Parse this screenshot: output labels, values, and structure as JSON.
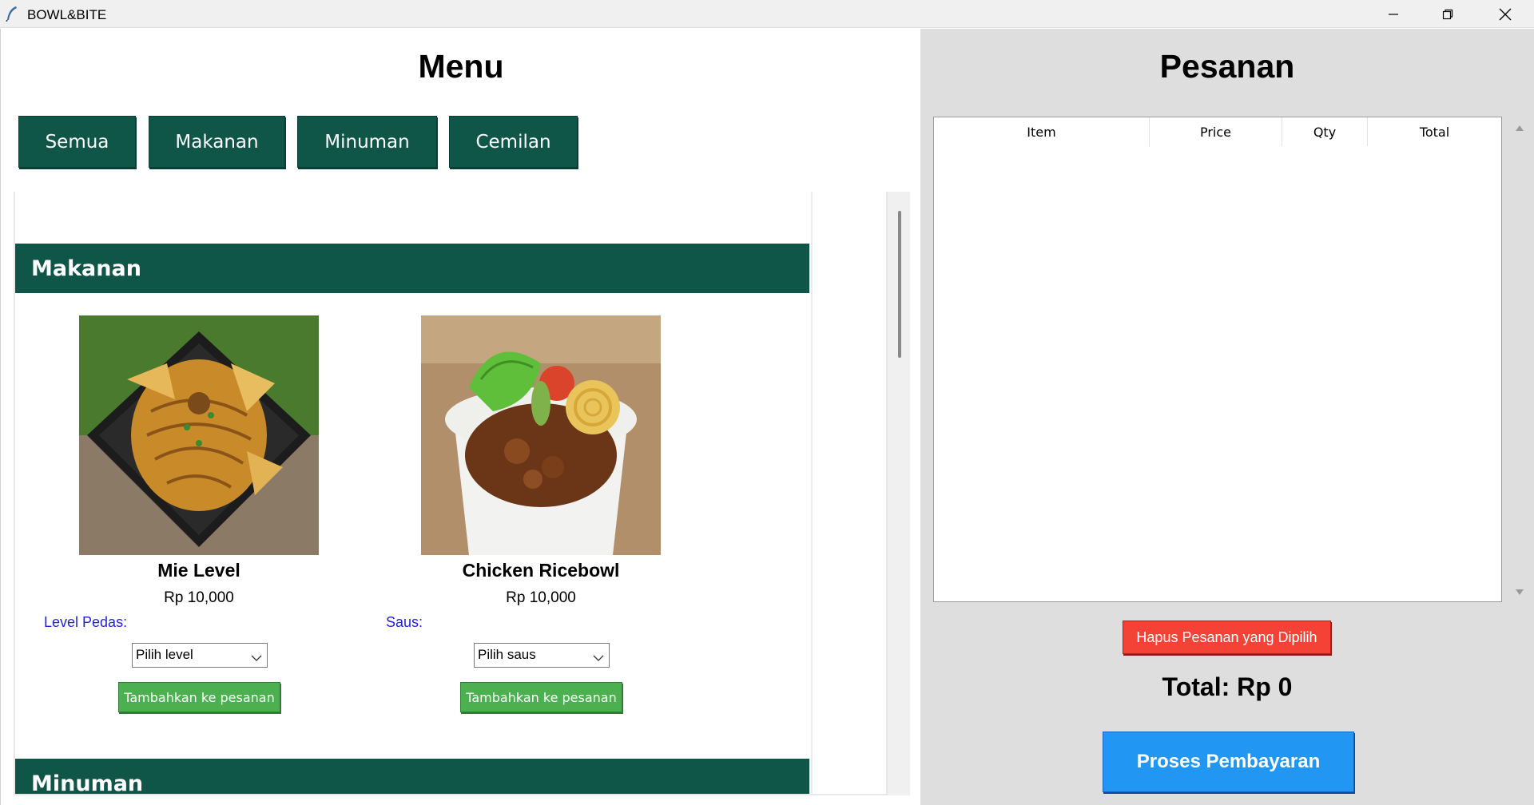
{
  "window": {
    "title": "BOWL&BITE",
    "controls": [
      "minimize-icon",
      "restore-icon",
      "close-icon"
    ]
  },
  "menu": {
    "title": "Menu",
    "filters": [
      "Semua",
      "Makanan",
      "Minuman",
      "Cemilan"
    ],
    "sections": [
      {
        "name": "Makanan",
        "items": [
          {
            "name": "Mie Level",
            "price": "Rp 10,000",
            "option_label": "Level Pedas:",
            "option_placeholder": "Pilih level",
            "add_label": "Tambahkan ke pesanan"
          },
          {
            "name": "Chicken Ricebowl",
            "price": "Rp 10,000",
            "option_label": "Saus:",
            "option_placeholder": "Pilih saus",
            "add_label": "Tambahkan ke pesanan"
          }
        ]
      },
      {
        "name": "Minuman",
        "items": []
      }
    ]
  },
  "order": {
    "title": "Pesanan",
    "columns": [
      "Item",
      "Price",
      "Qty",
      "Total"
    ],
    "rows": [],
    "delete_label": "Hapus Pesanan yang Dipilih",
    "total_label": "Total: Rp 0",
    "pay_label": "Proses Pembayaran"
  },
  "colors": {
    "header_green": "#0f5548",
    "add_green": "#4caf50",
    "delete_red": "#f44336",
    "pay_blue": "#2196f3",
    "option_label_blue": "#2323d9",
    "order_panel_bg": "#dedede"
  }
}
